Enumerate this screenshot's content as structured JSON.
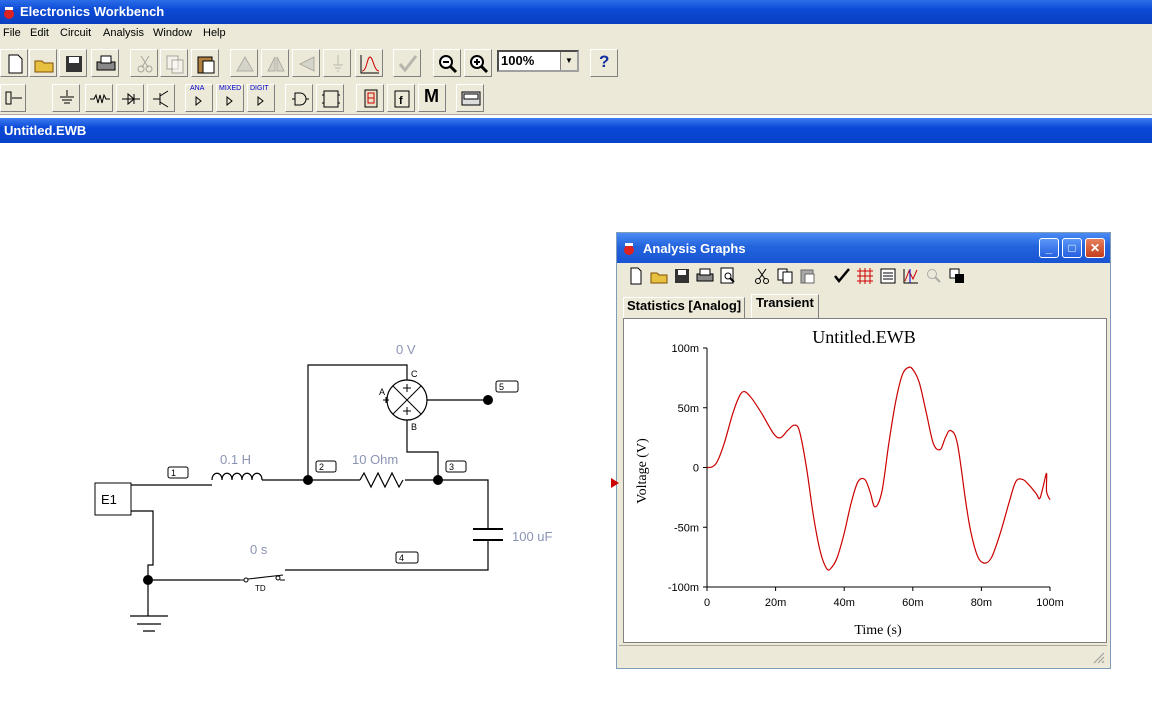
{
  "app": {
    "title": "Electronics Workbench"
  },
  "menu": [
    "File",
    "Edit",
    "Circuit",
    "Analysis",
    "Window",
    "Help"
  ],
  "toolbar": {
    "zoom_value": "100%",
    "help_label": "?"
  },
  "parts_toolbar": {
    "ana": "ANA",
    "mixed": "MIXED",
    "digit": "DIGIT",
    "misc": "M"
  },
  "document": {
    "title": "Untitled.EWB"
  },
  "circuit": {
    "source_label": "E1",
    "inductor_label": "0.1 H",
    "resistor_label": "10  Ohm",
    "capacitor_label": "100 uF",
    "voltmeter_label": "0 V",
    "switch_label": "0 s",
    "switch_tag": "TD",
    "meter_pins": {
      "a": "A",
      "b": "B",
      "c": "C"
    },
    "nodes": [
      "1",
      "2",
      "3",
      "4",
      "5"
    ]
  },
  "analysis_window": {
    "title": "Analysis Graphs",
    "tabs": [
      "Statistics [Analog]",
      "Transient"
    ],
    "active_tab": "Transient"
  },
  "chart_data": {
    "type": "line",
    "title": "Untitled.EWB",
    "xlabel": "Time (s)",
    "ylabel": "Voltage (V)",
    "xlim": [
      0,
      0.1
    ],
    "ylim": [
      -0.1,
      0.1
    ],
    "xticks": [
      0,
      0.02,
      0.04,
      0.06,
      0.08,
      0.1
    ],
    "xtick_labels": [
      "0",
      "20m",
      "40m",
      "60m",
      "80m",
      "100m"
    ],
    "yticks": [
      0.1,
      0.05,
      0,
      -0.05,
      -0.1
    ],
    "ytick_labels": [
      "100m",
      "50m",
      "0",
      "-50m",
      "-100m"
    ],
    "series": [
      {
        "color": "#cc0000",
        "x": [
          0,
          0.0015,
          0.003,
          0.005,
          0.0075,
          0.0095,
          0.011,
          0.013,
          0.016,
          0.0195,
          0.0215,
          0.0235,
          0.0255,
          0.027,
          0.029,
          0.031,
          0.033,
          0.035,
          0.0365,
          0.038,
          0.04,
          0.042,
          0.044,
          0.046,
          0.0475,
          0.049,
          0.051,
          0.053,
          0.055,
          0.057,
          0.059,
          0.0605,
          0.062,
          0.064,
          0.066,
          0.068,
          0.0695,
          0.071,
          0.073,
          0.0755,
          0.077,
          0.079,
          0.081,
          0.083,
          0.0855,
          0.088,
          0.09,
          0.092,
          0.094,
          0.096,
          0.097,
          0.098,
          0.099,
          0.099,
          0.1
        ],
        "y": [
          0.0,
          0.0005,
          0.005,
          0.02,
          0.045,
          0.06,
          0.0635,
          0.058,
          0.045,
          0.028,
          0.025,
          0.031,
          0.0355,
          0.03,
          0.0,
          -0.04,
          -0.07,
          -0.085,
          -0.083,
          -0.075,
          -0.055,
          -0.03,
          -0.012,
          -0.01,
          -0.02,
          -0.033,
          -0.02,
          0.02,
          0.055,
          0.078,
          0.084,
          0.08,
          0.07,
          0.045,
          0.02,
          0.015,
          0.025,
          0.031,
          0.02,
          -0.03,
          -0.055,
          -0.075,
          -0.08,
          -0.075,
          -0.055,
          -0.03,
          -0.012,
          -0.01,
          -0.015,
          -0.022,
          -0.026,
          -0.016,
          -0.005,
          -0.02,
          -0.027
        ]
      }
    ]
  }
}
